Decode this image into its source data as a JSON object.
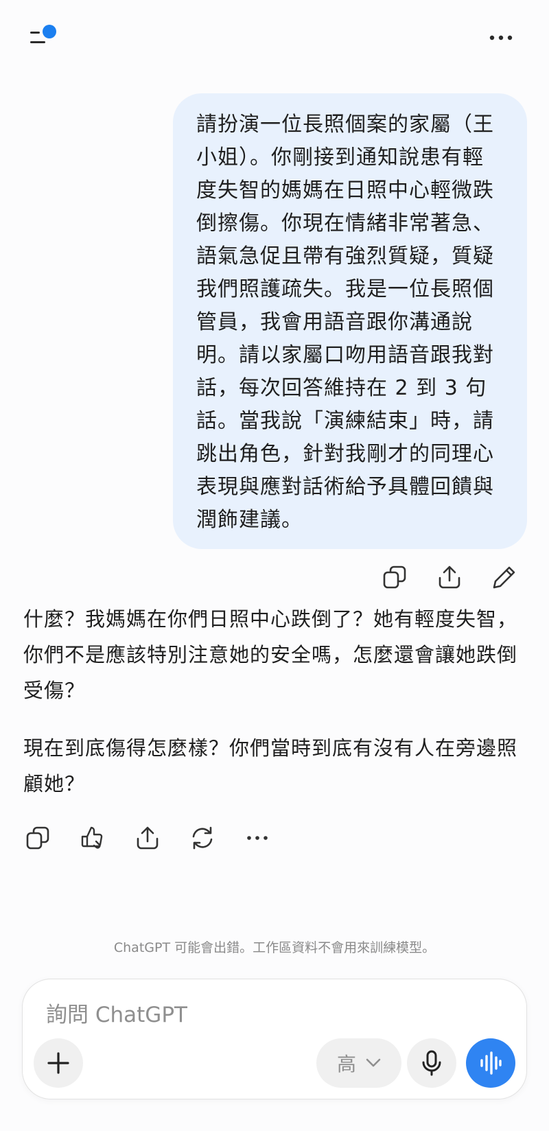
{
  "header": {
    "menu_icon": "sidebar-menu-icon",
    "more_icon": "ellipsis-icon",
    "accent_color": "#1b7ff0"
  },
  "conversation": {
    "user_message": "請扮演一位長照個案的家屬（王\n小姐）。你剛接到通知說患有輕\n度失智的媽媽在日照中心輕微跌\n倒擦傷。你現在情緒非常著急、\n語氣急促且帶有強烈質疑，質疑\n我們照護疏失。我是一位長照個\n管員，我會用語音跟你溝通說\n明。請以家屬口吻用語音跟我對\n話，每次回答維持在 2 到 3 句\n話。當我說「演練結束」時，請\n跳出角色，針對我剛才的同理心\n表現與應對話術給予具體回饋與\n潤飾建議。",
    "user_actions": [
      "copy-icon",
      "share-icon",
      "edit-icon"
    ],
    "assistant_paragraphs": [
      "什麼？我媽媽在你們日照中心跌倒了？她有輕度失智，你們不是應該特別注意她的安全嗎，怎麼還會讓她跌倒受傷？",
      "現在到底傷得怎麼樣？你們當時到底有沒有人在旁邊照顧她？"
    ],
    "assistant_actions": [
      "copy-icon",
      "thumbs-down-icon",
      "share-icon",
      "regenerate-icon",
      "more-icon"
    ]
  },
  "disclaimer": "ChatGPT 可能會出錯。工作區資料不會用來訓練模型。",
  "composer": {
    "placeholder": "詢問 ChatGPT",
    "quality_label": "高",
    "voice_color": "#2f84f2"
  }
}
